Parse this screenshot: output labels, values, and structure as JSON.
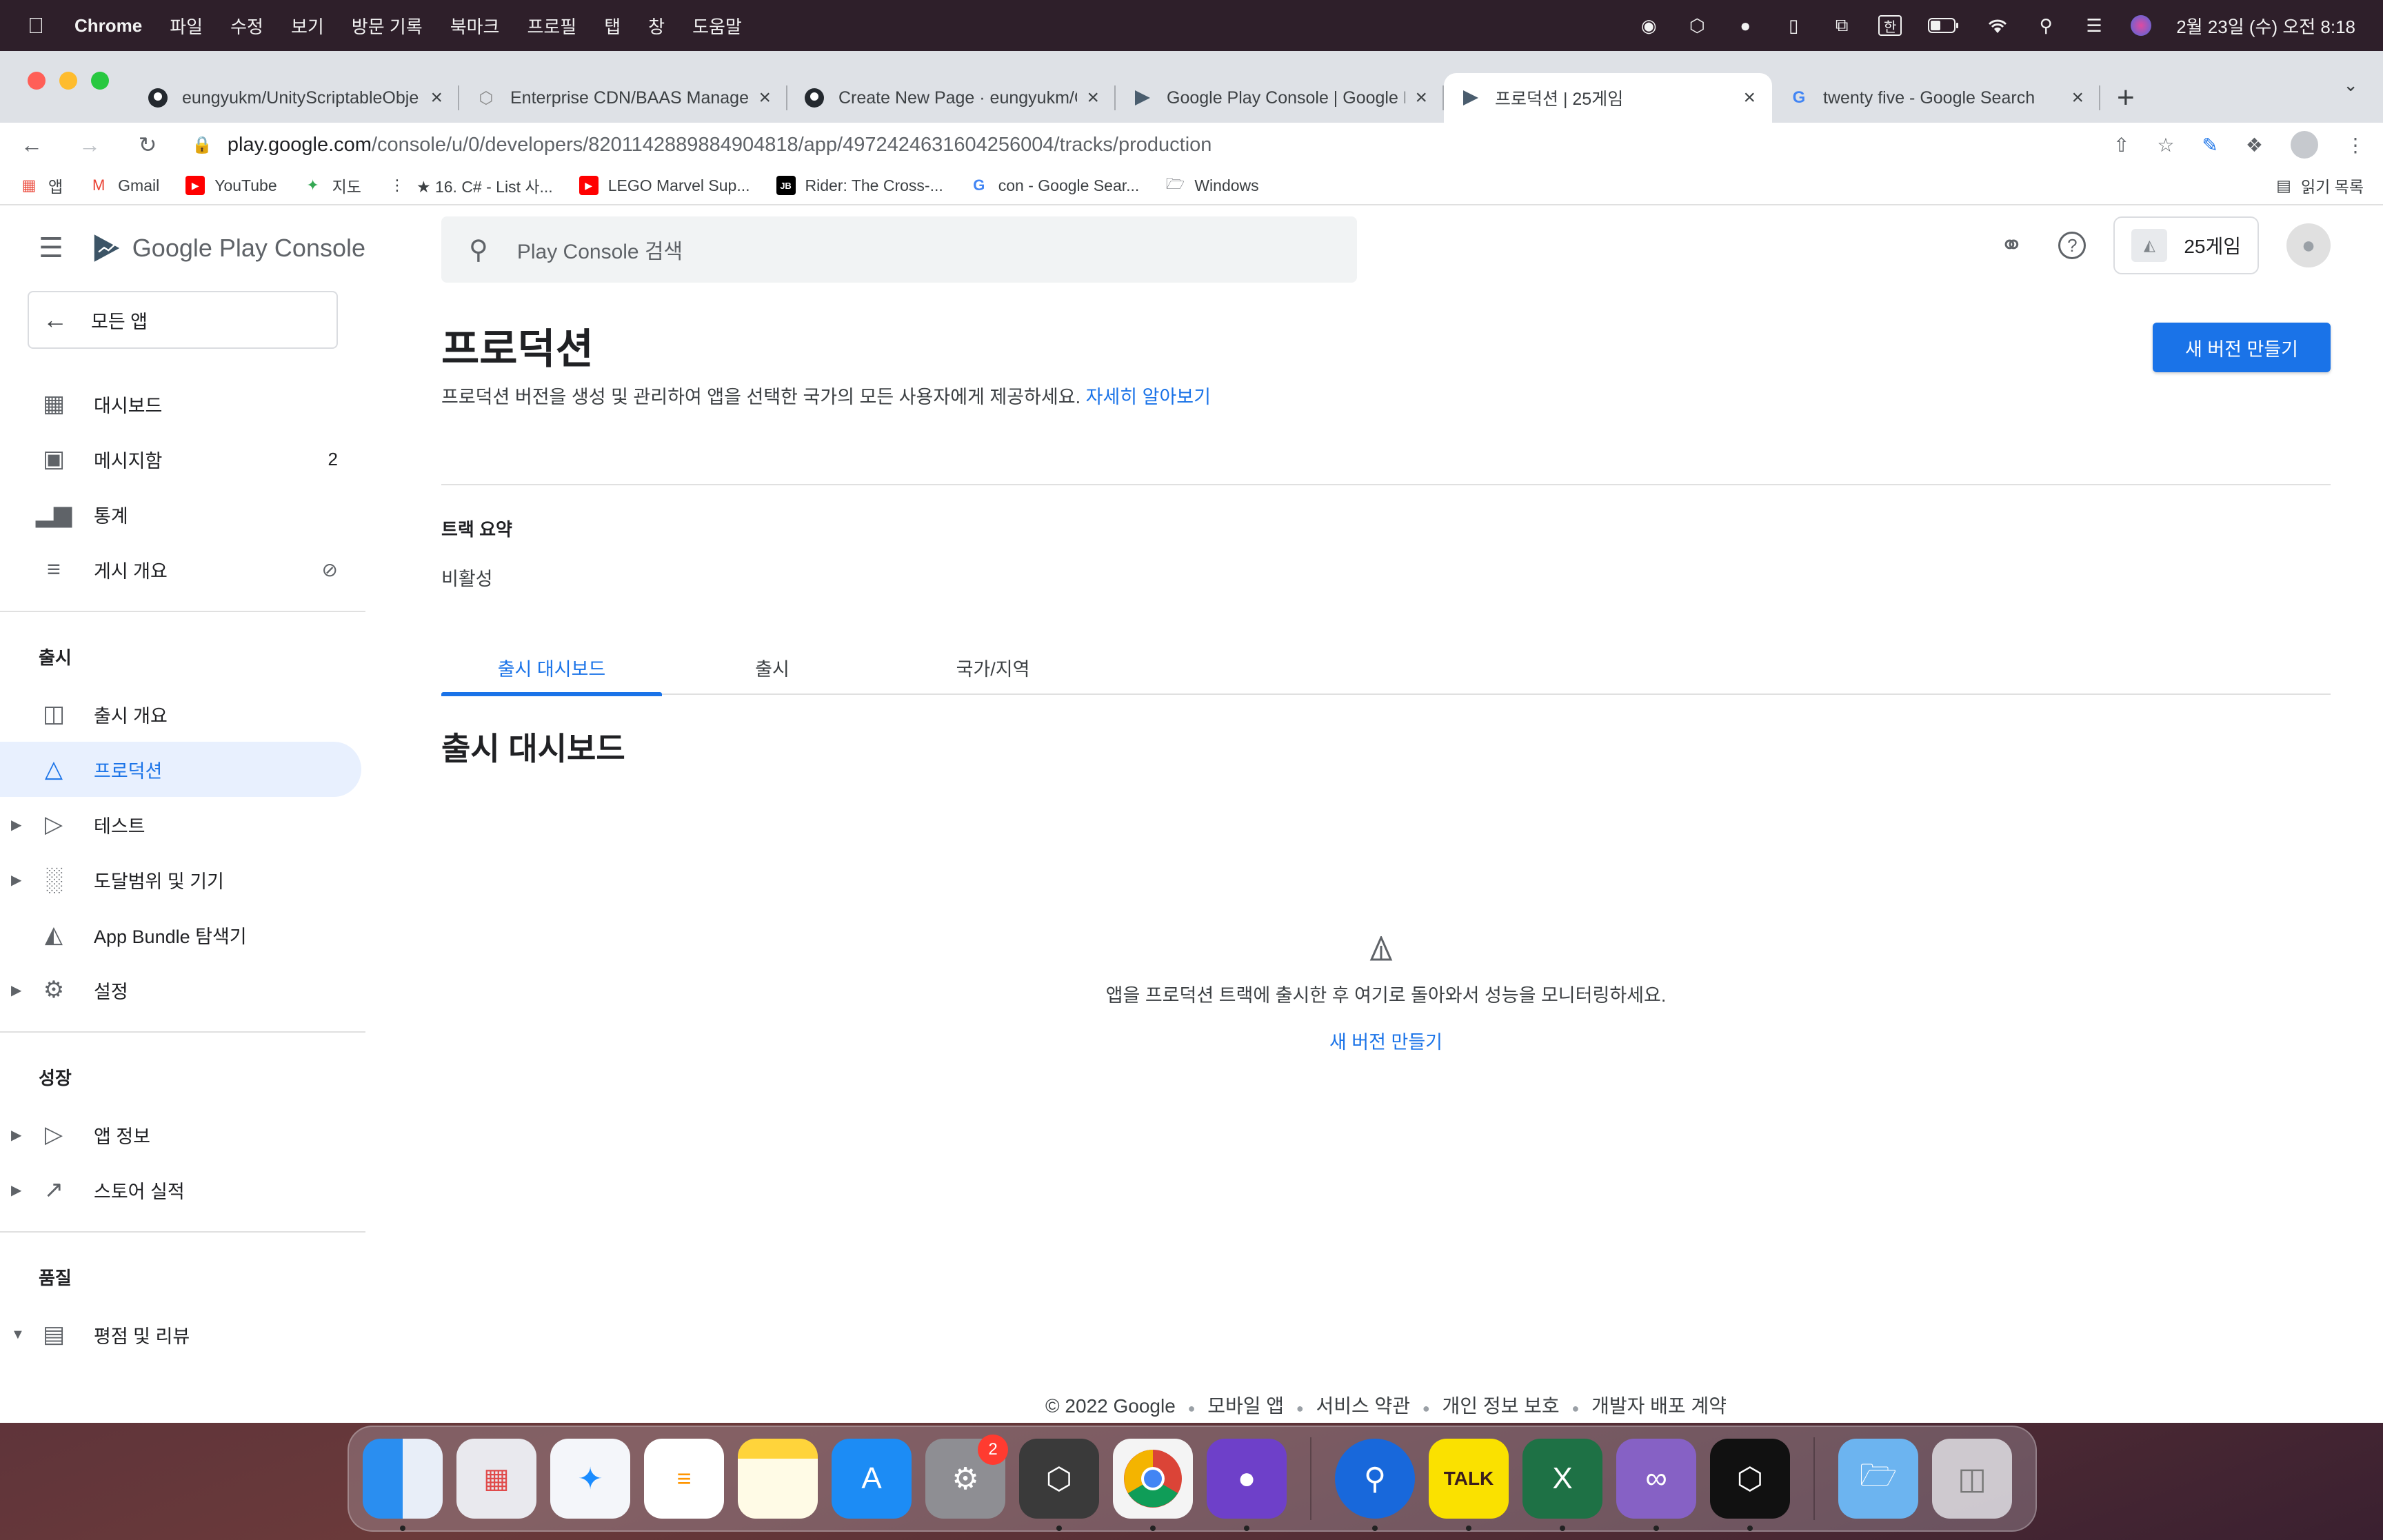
{
  "menubar": {
    "app_name": "Chrome",
    "menus": [
      "파일",
      "수정",
      "보기",
      "방문 기록",
      "북마크",
      "프로필",
      "탭",
      "창",
      "도움말"
    ],
    "clock": "2월 23일 (수) 오전 8:18",
    "ime": "한"
  },
  "browser": {
    "tabs": [
      {
        "title": "eungyukm/UnityScriptableObje",
        "favicon": "github-icon"
      },
      {
        "title": "Enterprise CDN/BAAS Manager",
        "favicon": "unity-icon"
      },
      {
        "title": "Create New Page · eungyukm/C",
        "favicon": "github-icon"
      },
      {
        "title": "Google Play Console | Google I",
        "favicon": "play-console-icon"
      },
      {
        "title": "프로덕션 | 25게임",
        "favicon": "play-console-icon"
      },
      {
        "title": "twenty five - Google Search",
        "favicon": "google-icon"
      }
    ],
    "active_tab_index": 4,
    "url_host": "play.google.com",
    "url_path": "/console/u/0/developers/8201142889884904818/app/4972424631604256004/tracks/production",
    "bookmarks": [
      {
        "label": "앱",
        "icon": "apps-grid-icon"
      },
      {
        "label": "Gmail",
        "icon": "gmail-icon"
      },
      {
        "label": "YouTube",
        "icon": "youtube-icon"
      },
      {
        "label": "지도",
        "icon": "maps-icon"
      },
      {
        "label": "★ 16. C# - List 사...",
        "icon": "dots-icon"
      },
      {
        "label": "LEGO Marvel Sup...",
        "icon": "youtube-icon"
      },
      {
        "label": "Rider: The Cross-...",
        "icon": "jetbrains-icon"
      },
      {
        "label": "con - Google Sear...",
        "icon": "google-icon"
      },
      {
        "label": "Windows",
        "icon": "folder-icon"
      }
    ],
    "reading_list": "읽기 목록"
  },
  "console": {
    "product_name": "Google Play Console",
    "back_label": "모든 앱",
    "search_placeholder": "Play Console 검색",
    "app_name": "25게임",
    "nav_top": [
      {
        "label": "대시보드",
        "icon": "dashboard-icon"
      },
      {
        "label": "메시지함",
        "icon": "inbox-icon",
        "badge": "2"
      },
      {
        "label": "통계",
        "icon": "bar-chart-icon"
      },
      {
        "label": "게시 개요",
        "icon": "publishing-icon"
      }
    ],
    "section_release": "출시",
    "nav_release": [
      {
        "label": "출시 개요",
        "icon": "release-overview-icon"
      },
      {
        "label": "프로덕션",
        "icon": "production-icon",
        "active": true
      },
      {
        "label": "테스트",
        "icon": "testing-icon",
        "expandable": true
      },
      {
        "label": "도달범위 및 기기",
        "icon": "reach-devices-icon",
        "expandable": true
      },
      {
        "label": "App Bundle 탐색기",
        "icon": "android-icon"
      },
      {
        "label": "설정",
        "icon": "gear-icon",
        "expandable": true
      }
    ],
    "section_growth": "성장",
    "nav_growth": [
      {
        "label": "앱 정보",
        "icon": "play-store-icon",
        "expandable": true
      },
      {
        "label": "스토어 실적",
        "icon": "trending-icon",
        "expandable": true
      }
    ],
    "section_quality": "품질",
    "nav_quality": [
      {
        "label": "평점 및 리뷰",
        "icon": "reviews-icon",
        "expandable": true
      }
    ],
    "page_title": "프로덕션",
    "page_desc": "프로덕션 버전을 생성 및 관리하여 앱을 선택한 국가의 모든 사용자에게 제공하세요.",
    "learn_more": "자세히 알아보기",
    "create_release": "새 버전 만들기",
    "summary_label": "트랙 요약",
    "summary_value": "비활성",
    "tabs": [
      "출시 대시보드",
      "출시",
      "국가/지역"
    ],
    "active_tab": 0,
    "section_title": "출시 대시보드",
    "empty_text": "앱을 프로덕션 트랙에 출시한 후 여기로 돌아와서 성능을 모니터링하세요.",
    "empty_link": "새 버전 만들기",
    "footer": {
      "copyright": "© 2022 Google",
      "links": [
        "모바일 앱",
        "서비스 약관",
        "개인 정보 보호",
        "개발자 배포 계약"
      ]
    }
  },
  "dock": {
    "apps": [
      "finder",
      "launchpad",
      "safari",
      "reminders",
      "notes",
      "app-store",
      "system-preferences",
      "unity-hub",
      "chrome",
      "github-desktop",
      "sourcetree",
      "kakaotalk",
      "excel",
      "visual-studio",
      "unity",
      "downloads-folder",
      "trash"
    ],
    "system_preferences_badge": "2",
    "kakaotalk_label": "TALK"
  },
  "colors": {
    "accent": "#1a73e8",
    "active_nav_bg": "#e8f0fe"
  }
}
